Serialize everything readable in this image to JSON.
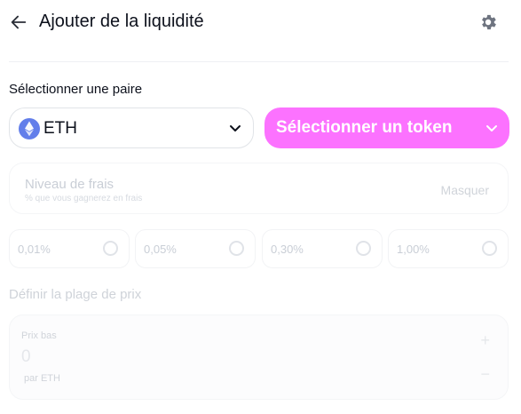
{
  "header": {
    "title": "Ajouter de la liquidité",
    "back_icon": "arrow-left-icon",
    "settings_icon": "gear-icon"
  },
  "pair": {
    "label": "Sélectionner une paire",
    "token_a": {
      "symbol": "ETH",
      "icon": "ethereum-icon"
    },
    "token_b": {
      "label": "Sélectionner un token"
    }
  },
  "fees": {
    "title": "Niveau de frais",
    "subtitle": "% que vous gagnerez en frais",
    "hide_label": "Masquer",
    "tiers": [
      {
        "label": "0,01%"
      },
      {
        "label": "0,05%"
      },
      {
        "label": "0,30%"
      },
      {
        "label": "1,00%"
      }
    ]
  },
  "range": {
    "label": "Définir la plage de prix",
    "low": {
      "label": "Prix bas",
      "value": "0",
      "unit": "par ETH",
      "increment": "+",
      "decrement": "−"
    }
  },
  "colors": {
    "accent_pink": "#fc72ff",
    "text_primary": "#0d111c",
    "disabled_text": "#c9ced6"
  }
}
